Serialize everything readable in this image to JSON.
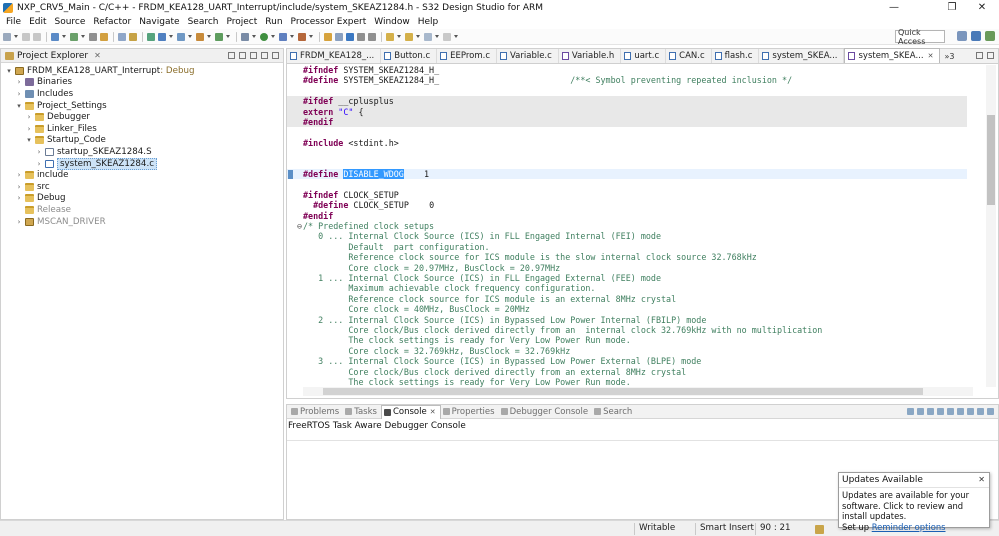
{
  "window": {
    "title": "NXP_CRV5_Main - C/C++ - FRDM_KEA128_UART_Interrupt/include/system_SKEAZ1284.h - S32 Design Studio for ARM",
    "controls": [
      "—",
      "❐",
      "✕"
    ]
  },
  "menu": [
    "File",
    "Edit",
    "Source",
    "Refactor",
    "Navigate",
    "Search",
    "Project",
    "Run",
    "Processor Expert",
    "Window",
    "Help"
  ],
  "toolbar": {
    "quick_access_placeholder": "Quick Access"
  },
  "explorer": {
    "title": "Project Explorer",
    "close": "✕",
    "tree": [
      {
        "level": 0,
        "expand": "▾",
        "icon": "project-icon",
        "label": "FRDM_KEA128_UART_Interrupt",
        "tag": ": Debug"
      },
      {
        "level": 1,
        "expand": "›",
        "icon": "binaries-icon",
        "label": "Binaries"
      },
      {
        "level": 1,
        "expand": "›",
        "icon": "includes-icon",
        "label": "Includes"
      },
      {
        "level": 1,
        "expand": "▾",
        "icon": "folder-icon",
        "label": "Project_Settings"
      },
      {
        "level": 2,
        "expand": "›",
        "icon": "folder-icon",
        "label": "Debugger"
      },
      {
        "level": 2,
        "expand": "›",
        "icon": "folder-icon",
        "label": "Linker_Files"
      },
      {
        "level": 2,
        "expand": "▾",
        "icon": "folder-icon",
        "label": "Startup_Code"
      },
      {
        "level": 3,
        "expand": "›",
        "icon": "asm-file-icon",
        "label": "startup_SKEAZ1284.S"
      },
      {
        "level": 3,
        "expand": "›",
        "icon": "c-file-icon",
        "label": "system_SKEAZ1284.c",
        "selected": true
      },
      {
        "level": 1,
        "expand": "›",
        "icon": "folder-icon",
        "label": "include"
      },
      {
        "level": 1,
        "expand": "›",
        "icon": "folder-icon",
        "label": "src"
      },
      {
        "level": 1,
        "expand": "›",
        "icon": "folder-icon",
        "label": "Debug"
      },
      {
        "level": 1,
        "expand": "",
        "icon": "folder-icon",
        "label": "Release",
        "dim": true
      },
      {
        "level": 1,
        "expand": "›",
        "icon": "project-icon",
        "label": "MSCAN_DRIVER",
        "dim": true
      }
    ]
  },
  "editor": {
    "tabs": [
      {
        "label": "FRDM_KEA128_...",
        "icon": "c-file-icon"
      },
      {
        "label": "Button.c",
        "icon": "c-file-icon"
      },
      {
        "label": "EEProm.c",
        "icon": "c-file-icon"
      },
      {
        "label": "Variable.c",
        "icon": "c-file-icon"
      },
      {
        "label": "Variable.h",
        "icon": "h-file-icon"
      },
      {
        "label": "uart.c",
        "icon": "c-file-icon"
      },
      {
        "label": "CAN.c",
        "icon": "c-file-icon"
      },
      {
        "label": "flash.c",
        "icon": "c-file-icon"
      },
      {
        "label": "system_SKEA...",
        "icon": "c-file-icon"
      },
      {
        "label": "system_SKEA...",
        "icon": "h-file-icon",
        "active": true
      }
    ],
    "overflow": "»3",
    "lines": [
      {
        "type": "define",
        "kw": "#ifndef",
        "rest": " SYSTEM_SKEAZ1284_H_"
      },
      {
        "type": "define_comment",
        "kw": "#define",
        "rest": " SYSTEM_SKEAZ1284_H_                          ",
        "comment": "/**< Symbol preventing repeated inclusion */"
      },
      {
        "type": "blank"
      },
      {
        "type": "define",
        "kw": "#ifdef",
        "rest": " __cplusplus",
        "shade": true
      },
      {
        "type": "extern",
        "kw": "extern",
        "str": " \"C\"",
        "rest": " {",
        "shade": true
      },
      {
        "type": "define",
        "kw": "#endif",
        "rest": "",
        "shade": true
      },
      {
        "type": "blank"
      },
      {
        "type": "include",
        "kw": "#include",
        "rest": " <stdint.h>"
      },
      {
        "type": "blank"
      },
      {
        "type": "blank"
      },
      {
        "type": "selected_define",
        "kw": "#define",
        "sel": "DISABLE_WDOG",
        "rest": "    1",
        "current": true
      },
      {
        "type": "blank"
      },
      {
        "type": "define",
        "kw": "#ifndef",
        "rest": " CLOCK_SETUP"
      },
      {
        "type": "define",
        "kw": "  #define",
        "rest": " CLOCK_SETUP    0"
      },
      {
        "type": "define",
        "kw": "#endif",
        "rest": ""
      },
      {
        "type": "comment",
        "fold": "⊖",
        "text": "/* Predefined clock setups"
      },
      {
        "type": "comment",
        "text": "   0 ... Internal Clock Source (ICS) in FLL Engaged Internal (FEI) mode"
      },
      {
        "type": "comment",
        "text": "         Default  part configuration."
      },
      {
        "type": "comment",
        "text": "         Reference clock source for ICS module is the slow internal clock source 32.768kHz"
      },
      {
        "type": "comment",
        "text": "         Core clock = 20.97MHz, BusClock = 20.97MHz"
      },
      {
        "type": "comment",
        "text": "   1 ... Internal Clock Source (ICS) in FLL Engaged External (FEE) mode"
      },
      {
        "type": "comment",
        "text": "         Maximum achievable clock frequency configuration."
      },
      {
        "type": "comment",
        "text": "         Reference clock source for ICS module is an external 8MHz crystal"
      },
      {
        "type": "comment",
        "text": "         Core clock = 40MHz, BusClock = 20MHz"
      },
      {
        "type": "comment",
        "text": "   2 ... Internal Clock Source (ICS) in Bypassed Low Power Internal (FBILP) mode"
      },
      {
        "type": "comment",
        "text": "         Core clock/Bus clock derived directly from an  internal clock 32.769kHz with no multiplication"
      },
      {
        "type": "comment",
        "text": "         The clock settings is ready for Very Low Power Run mode."
      },
      {
        "type": "comment",
        "text": "         Core clock = 32.769kHz, BusClock = 32.769kHz"
      },
      {
        "type": "comment",
        "text": "   3 ... Internal Clock Source (ICS) in Bypassed Low Power External (BLPE) mode"
      },
      {
        "type": "comment",
        "text": "         Core clock/Bus clock derived directly from an external 8MHz crystal"
      },
      {
        "type": "comment",
        "text": "         The clock settings is ready for Very Low Power Run mode."
      }
    ]
  },
  "console": {
    "tabs": [
      {
        "label": "Problems",
        "active": false
      },
      {
        "label": "Tasks",
        "active": false
      },
      {
        "label": "Console",
        "active": true
      },
      {
        "label": "Properties",
        "active": false
      },
      {
        "label": "Debugger Console",
        "active": false
      },
      {
        "label": "Search",
        "active": false
      }
    ],
    "close": "✕",
    "body": "FreeRTOS Task Aware Debugger Console"
  },
  "status": {
    "writable": "Writable",
    "insert_mode": "Smart Insert",
    "position": "90 : 21"
  },
  "updates_popup": {
    "title": "Updates Available",
    "close": "✕",
    "body": "Updates are available for your software. Click to review and install updates.",
    "setup_prefix": "Set up ",
    "link": "Reminder options"
  },
  "colors": {
    "keyword": "#7f0055",
    "comment": "#3f7f5f",
    "string": "#2a00ff",
    "selection": "#3399ff",
    "selected_tree_item": "#cde3f7",
    "current_line": "#e8f2fe"
  }
}
